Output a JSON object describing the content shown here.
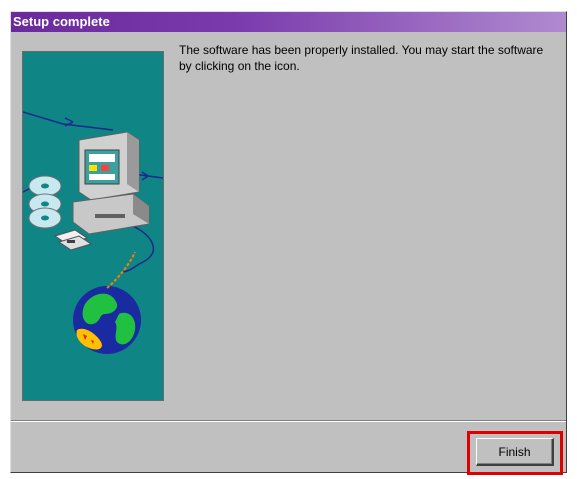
{
  "window": {
    "title": "Setup complete"
  },
  "message": {
    "text": "The software has been properly installed. You may start the software by clicking on the icon."
  },
  "buttons": {
    "finish_label": "Finish"
  },
  "illustration": {
    "background_color": "#0f8585",
    "icons": [
      "computer-icon",
      "cd-disc-icon",
      "floppy-disk-icon",
      "globe-icon"
    ]
  },
  "colors": {
    "titlebar": "#6a2a9c",
    "dialog_bg": "#c0c0c0",
    "highlight": "#e00000"
  }
}
